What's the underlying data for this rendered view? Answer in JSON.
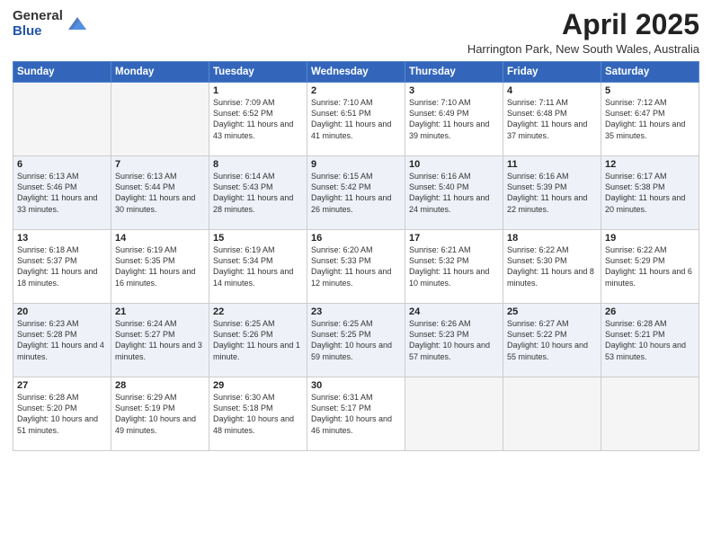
{
  "logo": {
    "general": "General",
    "blue": "Blue"
  },
  "title": "April 2025",
  "subtitle": "Harrington Park, New South Wales, Australia",
  "days_of_week": [
    "Sunday",
    "Monday",
    "Tuesday",
    "Wednesday",
    "Thursday",
    "Friday",
    "Saturday"
  ],
  "weeks": [
    [
      {
        "day": "",
        "info": ""
      },
      {
        "day": "",
        "info": ""
      },
      {
        "day": "1",
        "info": "Sunrise: 7:09 AM\nSunset: 6:52 PM\nDaylight: 11 hours and 43 minutes."
      },
      {
        "day": "2",
        "info": "Sunrise: 7:10 AM\nSunset: 6:51 PM\nDaylight: 11 hours and 41 minutes."
      },
      {
        "day": "3",
        "info": "Sunrise: 7:10 AM\nSunset: 6:49 PM\nDaylight: 11 hours and 39 minutes."
      },
      {
        "day": "4",
        "info": "Sunrise: 7:11 AM\nSunset: 6:48 PM\nDaylight: 11 hours and 37 minutes."
      },
      {
        "day": "5",
        "info": "Sunrise: 7:12 AM\nSunset: 6:47 PM\nDaylight: 11 hours and 35 minutes."
      }
    ],
    [
      {
        "day": "6",
        "info": "Sunrise: 6:13 AM\nSunset: 5:46 PM\nDaylight: 11 hours and 33 minutes."
      },
      {
        "day": "7",
        "info": "Sunrise: 6:13 AM\nSunset: 5:44 PM\nDaylight: 11 hours and 30 minutes."
      },
      {
        "day": "8",
        "info": "Sunrise: 6:14 AM\nSunset: 5:43 PM\nDaylight: 11 hours and 28 minutes."
      },
      {
        "day": "9",
        "info": "Sunrise: 6:15 AM\nSunset: 5:42 PM\nDaylight: 11 hours and 26 minutes."
      },
      {
        "day": "10",
        "info": "Sunrise: 6:16 AM\nSunset: 5:40 PM\nDaylight: 11 hours and 24 minutes."
      },
      {
        "day": "11",
        "info": "Sunrise: 6:16 AM\nSunset: 5:39 PM\nDaylight: 11 hours and 22 minutes."
      },
      {
        "day": "12",
        "info": "Sunrise: 6:17 AM\nSunset: 5:38 PM\nDaylight: 11 hours and 20 minutes."
      }
    ],
    [
      {
        "day": "13",
        "info": "Sunrise: 6:18 AM\nSunset: 5:37 PM\nDaylight: 11 hours and 18 minutes."
      },
      {
        "day": "14",
        "info": "Sunrise: 6:19 AM\nSunset: 5:35 PM\nDaylight: 11 hours and 16 minutes."
      },
      {
        "day": "15",
        "info": "Sunrise: 6:19 AM\nSunset: 5:34 PM\nDaylight: 11 hours and 14 minutes."
      },
      {
        "day": "16",
        "info": "Sunrise: 6:20 AM\nSunset: 5:33 PM\nDaylight: 11 hours and 12 minutes."
      },
      {
        "day": "17",
        "info": "Sunrise: 6:21 AM\nSunset: 5:32 PM\nDaylight: 11 hours and 10 minutes."
      },
      {
        "day": "18",
        "info": "Sunrise: 6:22 AM\nSunset: 5:30 PM\nDaylight: 11 hours and 8 minutes."
      },
      {
        "day": "19",
        "info": "Sunrise: 6:22 AM\nSunset: 5:29 PM\nDaylight: 11 hours and 6 minutes."
      }
    ],
    [
      {
        "day": "20",
        "info": "Sunrise: 6:23 AM\nSunset: 5:28 PM\nDaylight: 11 hours and 4 minutes."
      },
      {
        "day": "21",
        "info": "Sunrise: 6:24 AM\nSunset: 5:27 PM\nDaylight: 11 hours and 3 minutes."
      },
      {
        "day": "22",
        "info": "Sunrise: 6:25 AM\nSunset: 5:26 PM\nDaylight: 11 hours and 1 minute."
      },
      {
        "day": "23",
        "info": "Sunrise: 6:25 AM\nSunset: 5:25 PM\nDaylight: 10 hours and 59 minutes."
      },
      {
        "day": "24",
        "info": "Sunrise: 6:26 AM\nSunset: 5:23 PM\nDaylight: 10 hours and 57 minutes."
      },
      {
        "day": "25",
        "info": "Sunrise: 6:27 AM\nSunset: 5:22 PM\nDaylight: 10 hours and 55 minutes."
      },
      {
        "day": "26",
        "info": "Sunrise: 6:28 AM\nSunset: 5:21 PM\nDaylight: 10 hours and 53 minutes."
      }
    ],
    [
      {
        "day": "27",
        "info": "Sunrise: 6:28 AM\nSunset: 5:20 PM\nDaylight: 10 hours and 51 minutes."
      },
      {
        "day": "28",
        "info": "Sunrise: 6:29 AM\nSunset: 5:19 PM\nDaylight: 10 hours and 49 minutes."
      },
      {
        "day": "29",
        "info": "Sunrise: 6:30 AM\nSunset: 5:18 PM\nDaylight: 10 hours and 48 minutes."
      },
      {
        "day": "30",
        "info": "Sunrise: 6:31 AM\nSunset: 5:17 PM\nDaylight: 10 hours and 46 minutes."
      },
      {
        "day": "",
        "info": ""
      },
      {
        "day": "",
        "info": ""
      },
      {
        "day": "",
        "info": ""
      }
    ]
  ]
}
